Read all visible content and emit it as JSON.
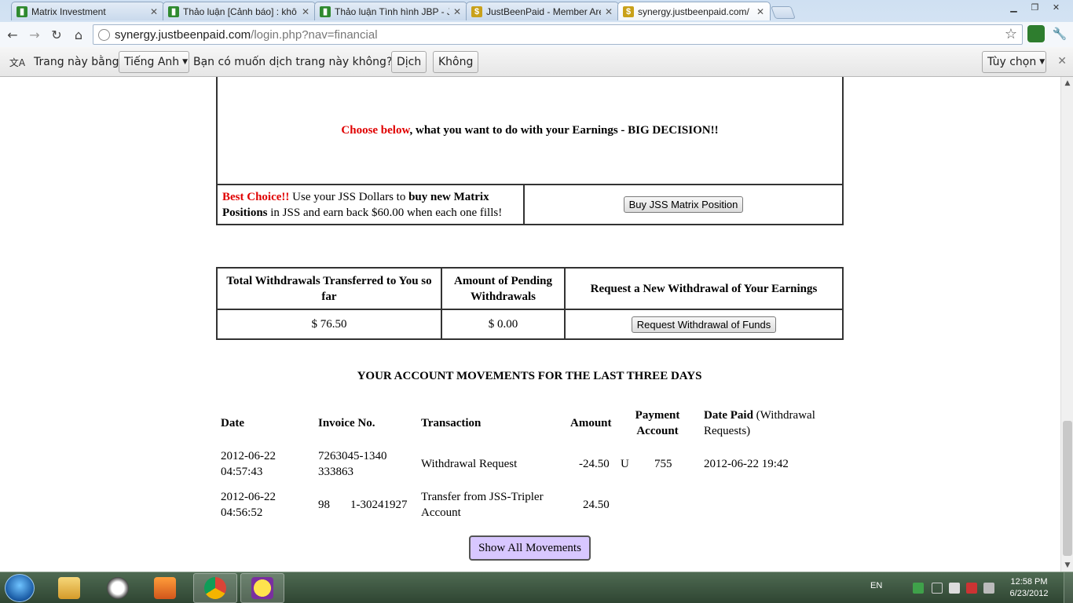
{
  "browser": {
    "tabs": [
      {
        "title": "Matrix Investment",
        "favicon": "green-logo-icon"
      },
      {
        "title": "Thảo luận [Cảnh báo] : khô",
        "favicon": "green-logo-icon"
      },
      {
        "title": "Thảo luận Tình hình JBP - J",
        "favicon": "green-logo-icon"
      },
      {
        "title": "JustBeenPaid - Member Are",
        "favicon": "dollar-icon"
      },
      {
        "title": "synergy.justbeenpaid.com/",
        "favicon": "dollar-icon"
      }
    ],
    "address": {
      "host": "synergy.justbeenpaid.com",
      "path": "/login.php?nav=financial"
    }
  },
  "translate_bar": {
    "prefix": "Trang này bằng",
    "language": "Tiếng Anh",
    "question": "Bạn có muốn dịch trang này không?",
    "translate_label": "Dịch",
    "no_label": "Không",
    "options_label": "Tùy chọn"
  },
  "earnings": {
    "choose_red": "Choose below",
    "choose_rest": ", what you want to do with your Earnings - BIG DECISION!!",
    "best_choice": "Best Choice!!",
    "desc_1": " Use your JSS Dollars to ",
    "desc_bold": "buy new Matrix Positions",
    "desc_2": " in JSS and earn back $60.00 when each one fills!",
    "buy_button": "Buy JSS Matrix Position"
  },
  "withdrawals": {
    "headers": [
      "Total Withdrawals Transferred to You so far",
      "Amount of Pending Withdrawals",
      "Request a New Withdrawal of Your Earnings"
    ],
    "total": "$ 76.50",
    "pending": "$ 0.00",
    "request_button": "Request Withdrawal of Funds"
  },
  "movements": {
    "title": "YOUR ACCOUNT MOVEMENTS FOR THE LAST THREE DAYS",
    "headers": {
      "date": "Date",
      "invoice": "Invoice No.",
      "transaction": "Transaction",
      "amount": "Amount",
      "payment_account": "Payment Account",
      "date_paid": "Date Paid",
      "date_paid_note": " (Withdrawal Requests)"
    },
    "rows": [
      {
        "date": "2012-06-22 04:57:43",
        "invoice": "7263045-1340333863",
        "transaction": "Withdrawal Request",
        "amount": "-24.50",
        "account_prefix": "U",
        "account": "755",
        "date_paid": "2012-06-22 19:42"
      },
      {
        "date": "2012-06-22 04:56:52",
        "invoice_a": "98",
        "invoice_b": "1-30241927",
        "transaction": "Transfer from JSS-Tripler Account",
        "amount": "24.50"
      }
    ],
    "show_all_button": "Show All Movements"
  },
  "taskbar": {
    "language": "EN",
    "time": "12:58 PM",
    "date": "6/23/2012"
  }
}
